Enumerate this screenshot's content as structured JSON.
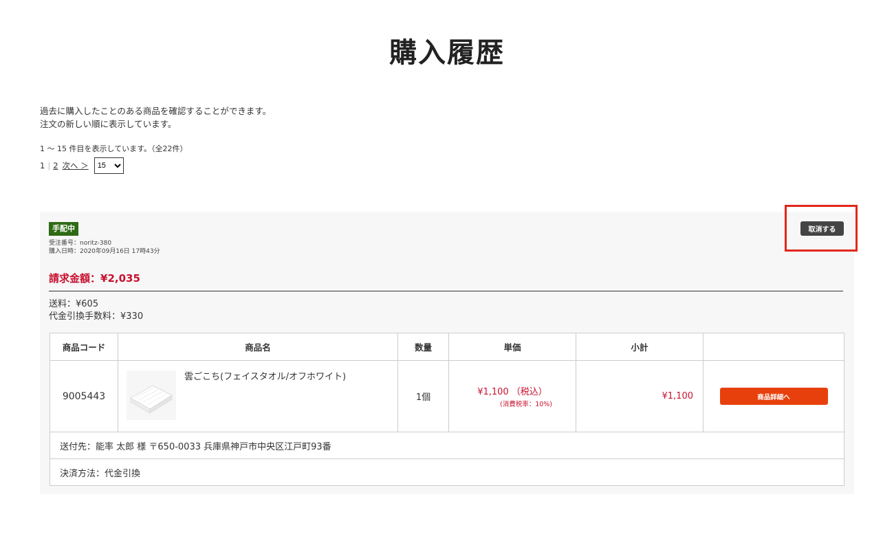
{
  "page": {
    "title": "購入履歴",
    "intro_line1": "過去に購入したことのある商品を確認することができます。",
    "intro_line2": "注文の新しい順に表示しています。"
  },
  "pagination": {
    "count_text": "1 ～ 15 件目を表示しています。（全22件）",
    "current": "1",
    "page2": "2",
    "next": "次へ ＞",
    "per_page_selected": "15"
  },
  "order": {
    "status": "手配中",
    "order_no": "受注番号：noritz-380",
    "purchase_date": "購入日時：2020年09月16日 17時43分",
    "cancel_label": "取消する",
    "total": "請求金額：¥2,035",
    "shipping_fee": "送料：¥605",
    "cod_fee": "代金引換手数料：¥330",
    "columns": [
      "商品コード",
      "商品名",
      "数量",
      "単価",
      "小計",
      ""
    ],
    "item": {
      "code": "9005443",
      "name": "雲ごこち(フェイスタオル/オフホワイト)",
      "qty": "1個",
      "price": "¥1,100 （税込）",
      "tax_rate": "(消費税率：10%)",
      "subtotal": "¥1,100",
      "detail_label": "商品詳細へ"
    },
    "ship_to": "送付先：能率 太郎 様 〒650-0033 兵庫県神戸市中央区江戸町93番",
    "payment": "決済方法：代金引換"
  },
  "colors": {
    "status_green": "#2f6b15",
    "price_red": "#c8102e",
    "detail_orange": "#e8400c",
    "highlight_red": "#e3261b",
    "cancel_gray": "#444444"
  }
}
